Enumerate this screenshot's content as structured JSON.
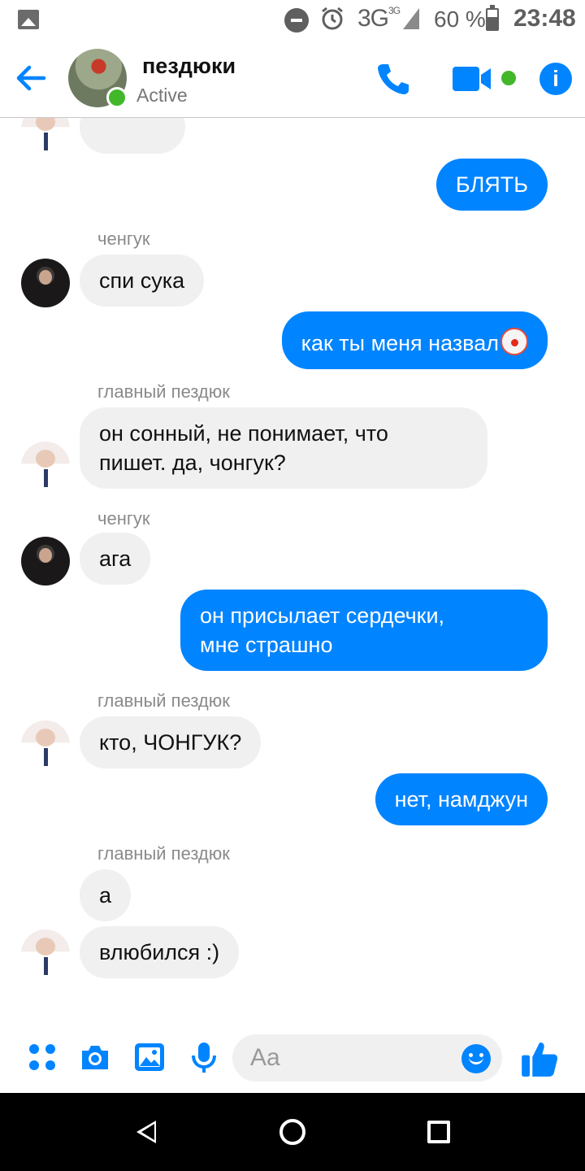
{
  "status_bar": {
    "network": "3G",
    "network_sup": "3G",
    "battery_percent": "60 %",
    "time": "23:48"
  },
  "header": {
    "title": "пездюки",
    "status": "Active",
    "accent_color": "#0084ff",
    "online_color": "#42b72a"
  },
  "messages": [
    {
      "kind": "out",
      "text": "БЛЯТЬ"
    },
    {
      "kind": "sender",
      "text": "ченгук"
    },
    {
      "kind": "in",
      "text": "спи сука"
    },
    {
      "kind": "out",
      "text": "как ты меня назвал",
      "emoji": "clown-face-icon"
    },
    {
      "kind": "sender",
      "text": "главный пездюк"
    },
    {
      "kind": "in",
      "text_lines": [
        "он сонный, не понимает, что",
        "пишет. да, чонгук?"
      ]
    },
    {
      "kind": "sender",
      "text": "ченгук"
    },
    {
      "kind": "in",
      "text": "ага"
    },
    {
      "kind": "out",
      "text_lines": [
        "он присылает сердечки,",
        "мне страшно"
      ]
    },
    {
      "kind": "sender",
      "text": "главный пездюк"
    },
    {
      "kind": "in",
      "text": "кто, ЧОНГУК?"
    },
    {
      "kind": "out",
      "text": "нет, намджун"
    },
    {
      "kind": "sender",
      "text": "главный пездюк"
    },
    {
      "kind": "in",
      "text": "а"
    },
    {
      "kind": "in",
      "text": "влюбился :)"
    }
  ],
  "composer": {
    "placeholder": "Aa",
    "icons": [
      "more-icon",
      "camera-icon",
      "gallery-icon",
      "microphone-icon",
      "emoji-icon",
      "thumbs-up-icon"
    ]
  }
}
